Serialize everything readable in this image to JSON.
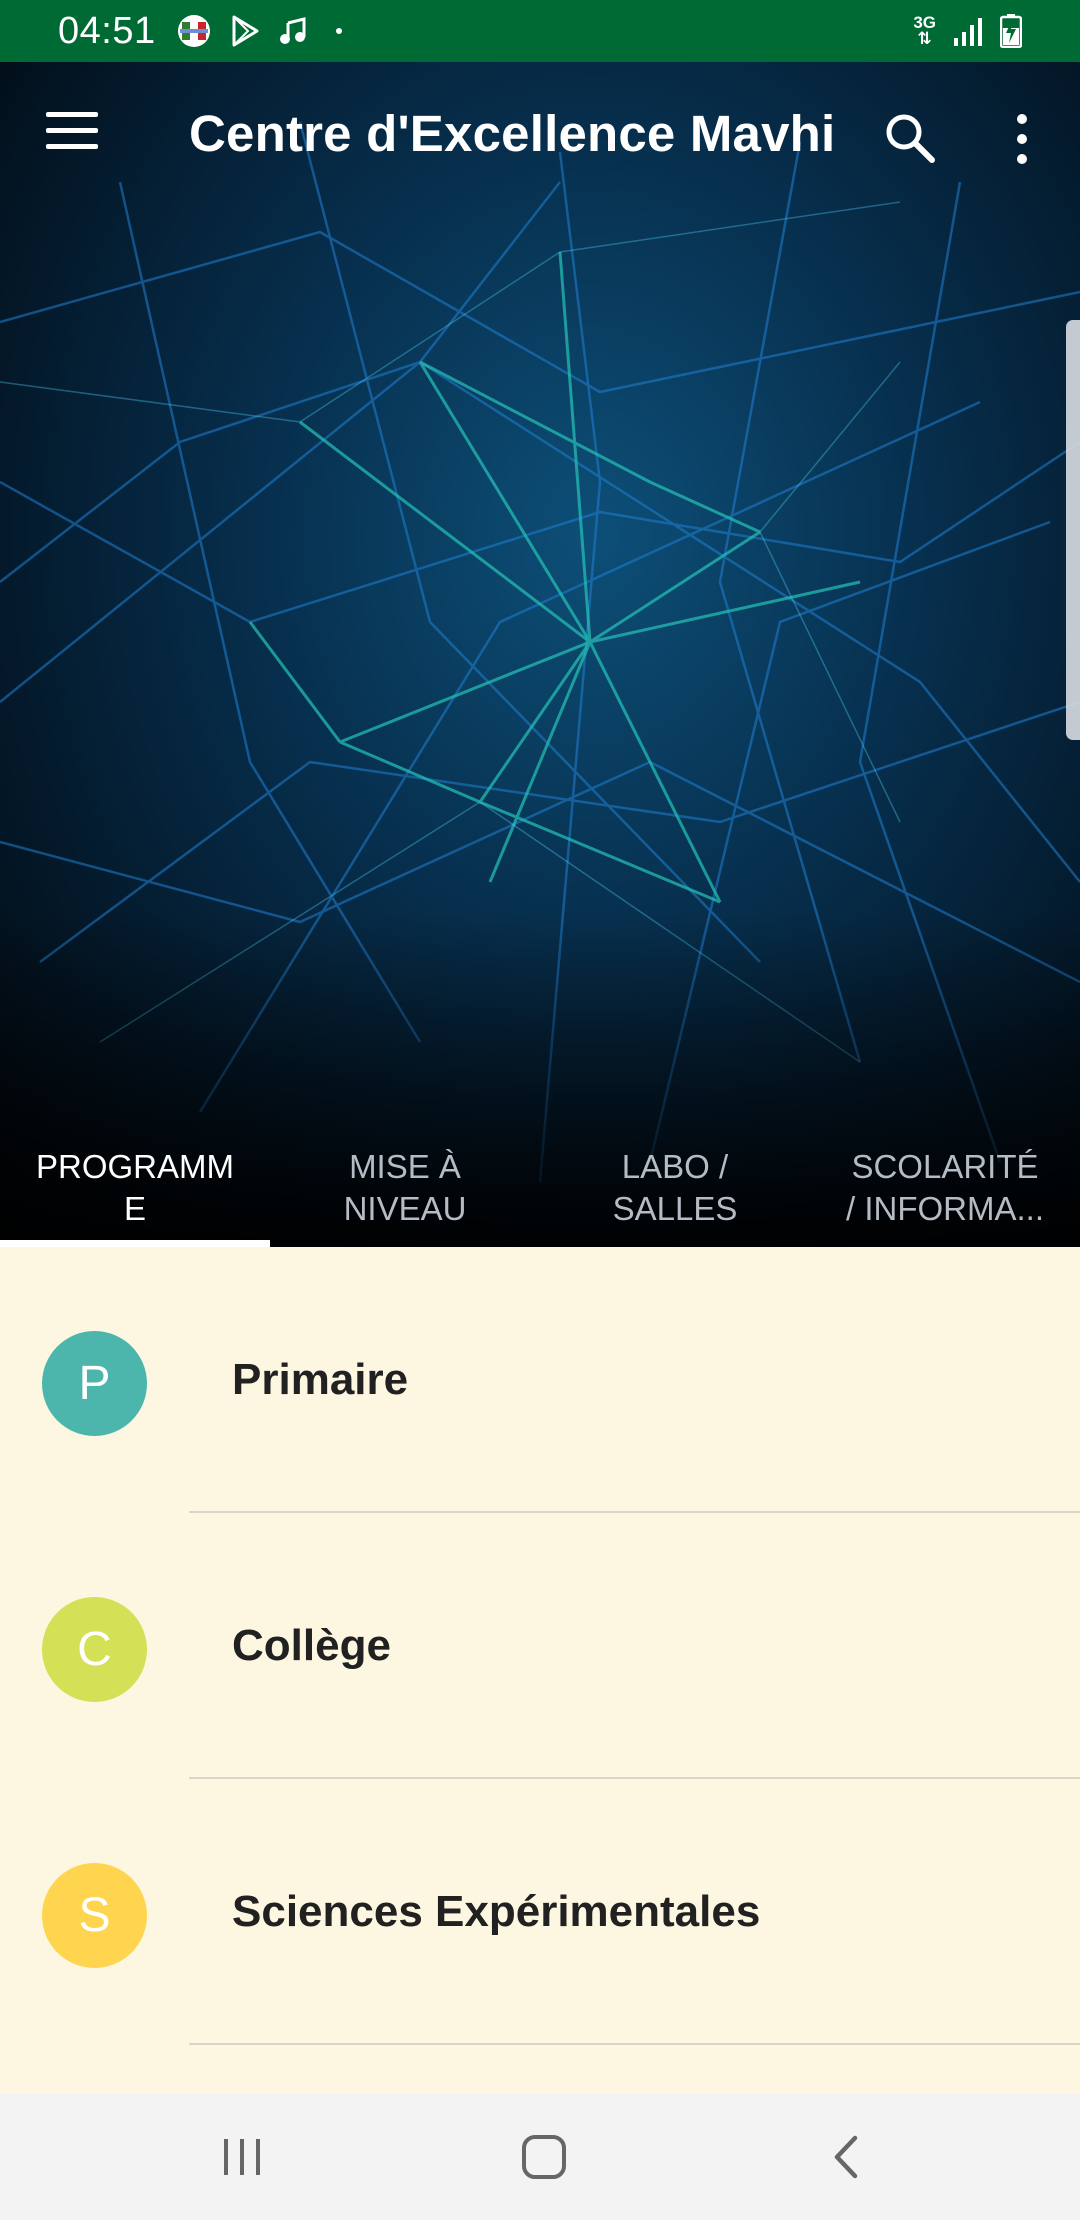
{
  "status_bar": {
    "time": "04:51",
    "network": "3G",
    "left_icons": [
      "flag-notification-icon",
      "play-store-icon",
      "music-icon",
      "dot-icon"
    ],
    "right_icons": [
      "network-3g-icon",
      "signal-icon",
      "battery-charging-icon"
    ]
  },
  "app_bar": {
    "title": "Centre d'Excellence Mavhi",
    "icons": [
      "menu-icon",
      "search-icon",
      "more-vert-icon"
    ]
  },
  "tabs": [
    {
      "label": "PROGRAMM\nE",
      "active": true
    },
    {
      "label": "MISE À\nNIVEAU",
      "active": false
    },
    {
      "label": "LABO /\nSALLES",
      "active": false
    },
    {
      "label": "SCOLARITÉ\n/ INFORMA...",
      "active": false
    }
  ],
  "list": {
    "items": [
      {
        "initial": "P",
        "label": "Primaire",
        "color": "#4db6ac"
      },
      {
        "initial": "C",
        "label": "Collège",
        "color": "#d4e157"
      },
      {
        "initial": "S",
        "label": "Sciences Expérimentales",
        "color": "#ffd54f"
      }
    ]
  },
  "nav_bar": {
    "buttons": [
      "recent-apps-icon",
      "home-icon",
      "back-icon"
    ]
  },
  "colors": {
    "status_bar": "#006a34",
    "list_background": "#fdf7e2",
    "nav_bar": "#f3f3f3"
  }
}
